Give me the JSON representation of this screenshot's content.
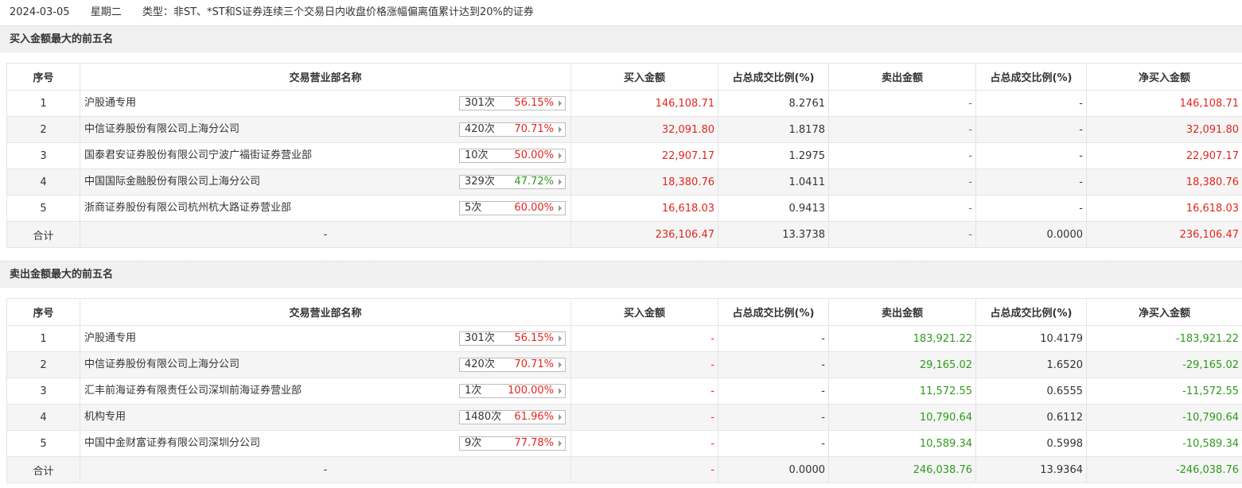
{
  "header": {
    "date": "2024-03-05",
    "weekday": "星期二",
    "type": "类型：非ST、*ST和S证券连续三个交易日内收盘价格涨幅偏离值累计达到20%的证券"
  },
  "colors": {
    "red": "#e4261e",
    "green": "#2e9a1c"
  },
  "columns": [
    "序号",
    "交易营业部名称",
    "买入金额",
    "占总成交比例(%)",
    "卖出金额",
    "占总成交比例(%)",
    "净买入金额"
  ],
  "buy_section": {
    "title": "买入金额最大的前五名",
    "rows": [
      {
        "idx": "1",
        "name": "沪股通专用",
        "count": "301次",
        "pct": "56.15%",
        "pct_color": "red",
        "buy": "146,108.71",
        "buy_ratio": "8.2761",
        "sell": "-",
        "sell_ratio": "-",
        "net": "146,108.71"
      },
      {
        "idx": "2",
        "name": "中信证券股份有限公司上海分公司",
        "count": "420次",
        "pct": "70.71%",
        "pct_color": "red",
        "buy": "32,091.80",
        "buy_ratio": "1.8178",
        "sell": "-",
        "sell_ratio": "-",
        "net": "32,091.80"
      },
      {
        "idx": "3",
        "name": "国泰君安证券股份有限公司宁波广福街证券营业部",
        "count": "10次",
        "pct": "50.00%",
        "pct_color": "red",
        "buy": "22,907.17",
        "buy_ratio": "1.2975",
        "sell": "-",
        "sell_ratio": "-",
        "net": "22,907.17"
      },
      {
        "idx": "4",
        "name": "中国国际金融股份有限公司上海分公司",
        "count": "329次",
        "pct": "47.72%",
        "pct_color": "green",
        "buy": "18,380.76",
        "buy_ratio": "1.0411",
        "sell": "-",
        "sell_ratio": "-",
        "net": "18,380.76"
      },
      {
        "idx": "5",
        "name": "浙商证券股份有限公司杭州杭大路证券营业部",
        "count": "5次",
        "pct": "60.00%",
        "pct_color": "red",
        "buy": "16,618.03",
        "buy_ratio": "0.9413",
        "sell": "-",
        "sell_ratio": "-",
        "net": "16,618.03"
      }
    ],
    "total": {
      "label": "合计",
      "name": "-",
      "buy": "236,106.47",
      "buy_ratio": "13.3738",
      "sell": "-",
      "sell_ratio": "0.0000",
      "net": "236,106.47"
    }
  },
  "sell_section": {
    "title": "卖出金额最大的前五名",
    "rows": [
      {
        "idx": "1",
        "name": "沪股通专用",
        "count": "301次",
        "pct": "56.15%",
        "pct_color": "red",
        "buy": "-",
        "buy_ratio": "-",
        "sell": "183,921.22",
        "sell_ratio": "10.4179",
        "net": "-183,921.22"
      },
      {
        "idx": "2",
        "name": "中信证券股份有限公司上海分公司",
        "count": "420次",
        "pct": "70.71%",
        "pct_color": "red",
        "buy": "-",
        "buy_ratio": "-",
        "sell": "29,165.02",
        "sell_ratio": "1.6520",
        "net": "-29,165.02"
      },
      {
        "idx": "3",
        "name": "汇丰前海证券有限责任公司深圳前海证券营业部",
        "count": "1次",
        "pct": "100.00%",
        "pct_color": "red",
        "buy": "-",
        "buy_ratio": "-",
        "sell": "11,572.55",
        "sell_ratio": "0.6555",
        "net": "-11,572.55"
      },
      {
        "idx": "4",
        "name": "机构专用",
        "count": "1480次",
        "pct": "61.96%",
        "pct_color": "red",
        "buy": "-",
        "buy_ratio": "-",
        "sell": "10,790.64",
        "sell_ratio": "0.6112",
        "net": "-10,790.64"
      },
      {
        "idx": "5",
        "name": "中国中金财富证券有限公司深圳分公司",
        "count": "9次",
        "pct": "77.78%",
        "pct_color": "red",
        "buy": "-",
        "buy_ratio": "-",
        "sell": "10,589.34",
        "sell_ratio": "0.5998",
        "net": "-10,589.34"
      }
    ],
    "total": {
      "label": "合计",
      "name": "-",
      "buy": "-",
      "buy_ratio": "0.0000",
      "sell": "246,038.76",
      "sell_ratio": "13.9364",
      "net": "-246,038.76"
    }
  }
}
